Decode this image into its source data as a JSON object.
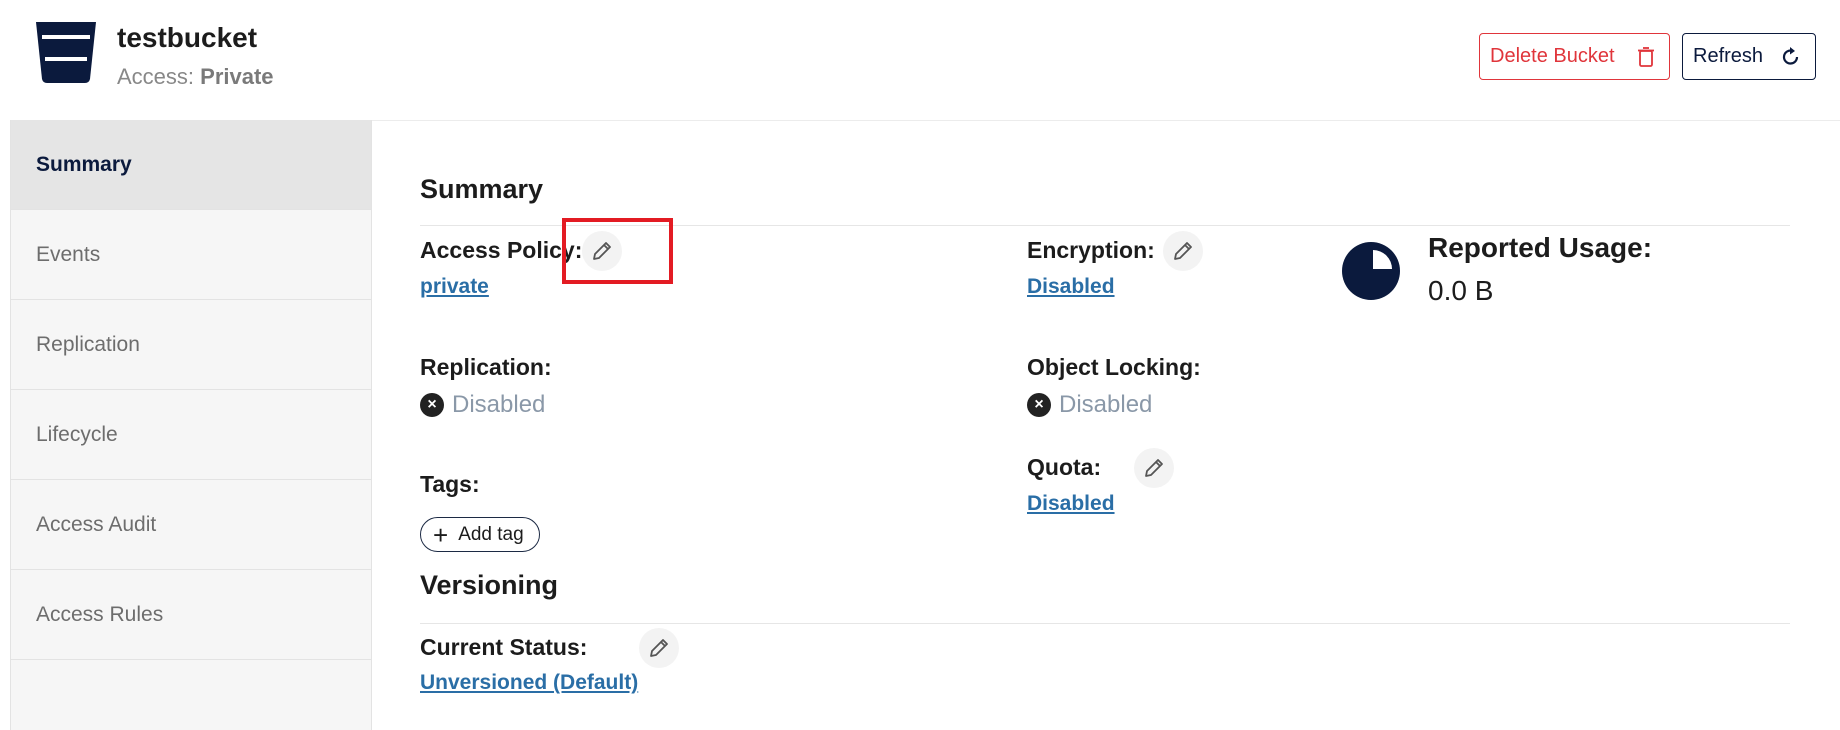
{
  "header": {
    "bucket_name": "testbucket",
    "access_label": "Access:",
    "access_value": "Private",
    "delete_label": "Delete Bucket",
    "refresh_label": "Refresh"
  },
  "sidebar": {
    "items": [
      {
        "label": "Summary",
        "active": true
      },
      {
        "label": "Events"
      },
      {
        "label": "Replication"
      },
      {
        "label": "Lifecycle"
      },
      {
        "label": "Access Audit"
      },
      {
        "label": "Access Rules"
      }
    ]
  },
  "summary": {
    "title": "Summary",
    "access_policy_label": "Access Policy:",
    "access_policy_value": "private",
    "encryption_label": "Encryption:",
    "encryption_value": "Disabled",
    "replication_label": "Replication:",
    "replication_value": "Disabled",
    "object_locking_label": "Object Locking:",
    "object_locking_value": "Disabled",
    "tags_label": "Tags:",
    "add_tag_label": "Add tag",
    "quota_label": "Quota:",
    "quota_value": "Disabled",
    "usage_label": "Reported Usage:",
    "usage_value": "0.0 B"
  },
  "versioning": {
    "title": "Versioning",
    "status_label": "Current Status:",
    "status_value": "Unversioned (Default)"
  },
  "colors": {
    "accent_navy": "#0b1a3d",
    "danger": "#e0353b",
    "link": "#2a6ea6",
    "highlight": "#e31b23"
  }
}
